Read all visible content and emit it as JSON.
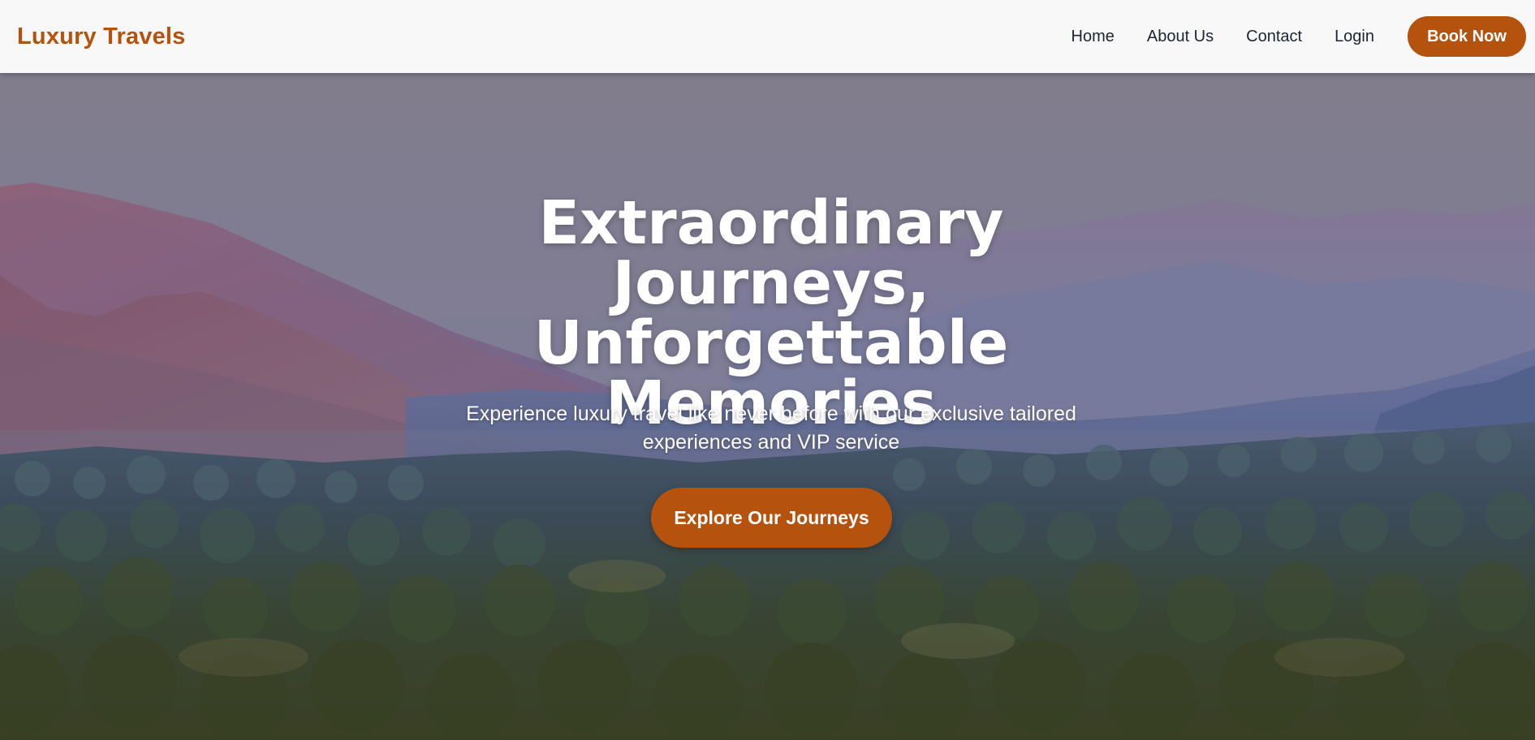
{
  "brand": {
    "name": "Luxury Travels"
  },
  "nav": {
    "links": [
      {
        "label": "Home"
      },
      {
        "label": "About Us"
      },
      {
        "label": "Contact"
      },
      {
        "label": "Login"
      }
    ],
    "cta_label": "Book Now"
  },
  "hero": {
    "title": "Extraordinary Journeys, Unforgettable Memories",
    "subtitle": "Experience luxury travel like never before with our exclusive tailored experiences and VIP service",
    "cta_label": "Explore Our Journeys",
    "background_description_icon": "mountain-oasis-image"
  },
  "colors": {
    "accent": "#b5520d",
    "nav_background": "#f8f8f8",
    "nav_text": "#1f2430",
    "hero_text": "#ffffff"
  }
}
